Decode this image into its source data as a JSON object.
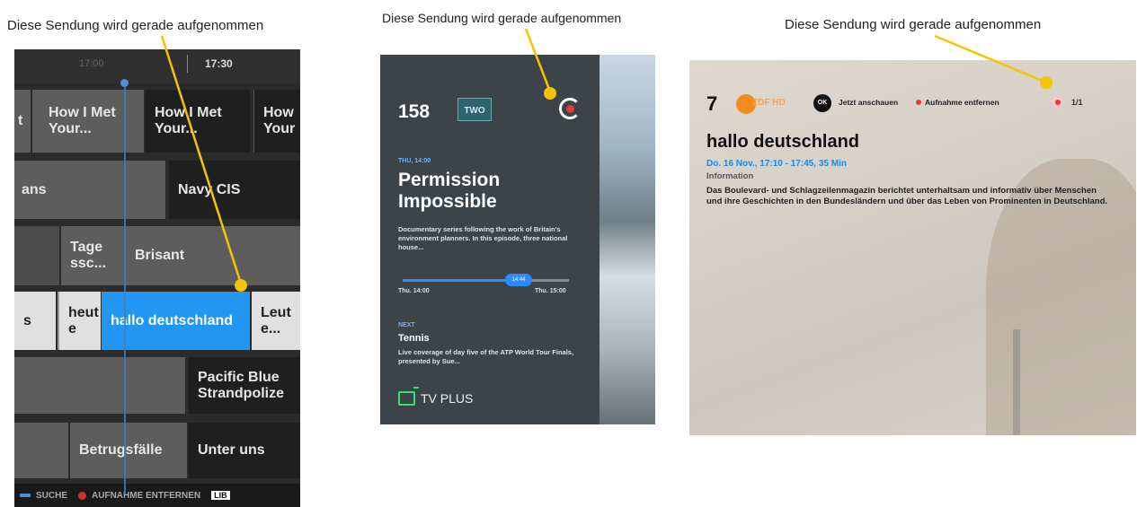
{
  "captions": {
    "left": "Diese Sendung wird gerade aufgenommen",
    "middle": "Diese Sendung wird gerade aufgenommen",
    "right": "Diese Sendung wird gerade aufgenommen"
  },
  "colors": {
    "callout": "#f5c400",
    "highlight": "#2196f3",
    "record": "#e53935"
  },
  "epg": {
    "time_faint": "17:00",
    "time_now": "17:30",
    "rows": [
      [
        "t",
        "How I Met Your...",
        "How I Met Your...",
        "How Your"
      ],
      [
        "ans",
        "Navy CIS"
      ],
      [
        "Tage ssc...",
        "Brisant"
      ],
      [
        "s",
        "heut e",
        "hallo deutschland",
        "Leut e..."
      ],
      [
        "Pacific Blue Strandpolize"
      ],
      [
        "Betrugsfälle",
        "Unter uns"
      ]
    ],
    "bottom_bar": {
      "search": "SUCHE",
      "remove_recording": "AUFNAHME ENTFERNEN",
      "library": "LIB"
    }
  },
  "mobile": {
    "channel_number": "158",
    "channel_logo": "TWO",
    "now_label": "THU, 14:00",
    "title": "Permission Impossible",
    "description": "Documentary series following the work of Britain's environment planners. In this episode, three national house...",
    "progress_fraction": 0.66,
    "progress_badge": "14:44",
    "time_start": "Thu. 14:00",
    "time_end": "Thu. 15:00",
    "next_label": "NEXT",
    "next_title": "Tennis",
    "next_description": "Live coverage of day five of the ATP World Tour Finals, presented by Sue...",
    "brand": "TV PLUS"
  },
  "tv": {
    "channel_number": "7",
    "channel_logo": "ZDF HD",
    "ok_label": "OK",
    "watch_now": "Jetzt anschauen",
    "remove_recording": "Aufnahme entfernen",
    "page_indicator": "1/1",
    "title": "hallo deutschland",
    "time": "Do. 16 Nov., 17:10 - 17:45, 35 Min",
    "genre": "Information",
    "description": "Das Boulevard- und Schlagzeilenmagazin berichtet unterhaltsam und informativ über Menschen und ihre Geschichten in den Bundesländern und über das Leben von Prominenten in Deutschland."
  }
}
